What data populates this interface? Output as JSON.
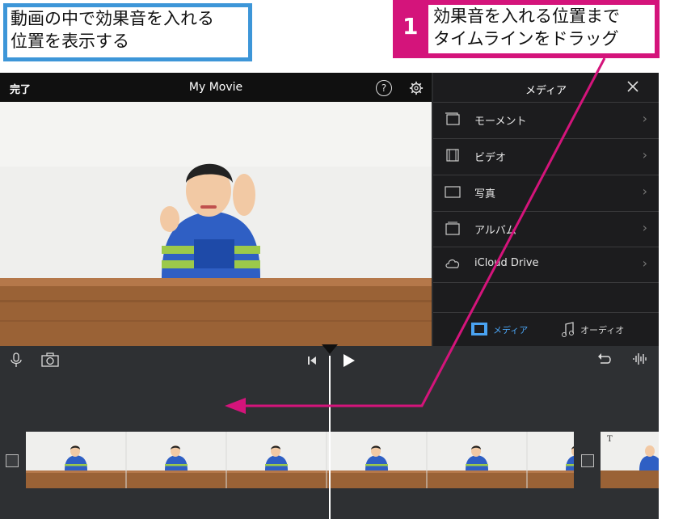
{
  "callouts": {
    "blue_line1": "動画の中で効果音を入れる",
    "blue_line2": "位置を表示する",
    "step_number": "1",
    "pink_line1": "効果音を入れる位置まで",
    "pink_line2": "タイムラインをドラッグ",
    "accent_blue": "#3d96d8",
    "accent_pink": "#d4147b"
  },
  "toolbar": {
    "done_label": "完了",
    "title": "My Movie",
    "help_glyph": "?"
  },
  "media_panel": {
    "title": "メディア",
    "items": [
      {
        "label": "モーメント",
        "icon": "moments-icon"
      },
      {
        "label": "ビデオ",
        "icon": "film-icon"
      },
      {
        "label": "写真",
        "icon": "photo-icon"
      },
      {
        "label": "アルバム",
        "icon": "album-icon"
      },
      {
        "label": "iCloud Drive",
        "icon": "cloud-icon"
      }
    ],
    "tabs": [
      {
        "label": "メディア",
        "icon": "film-icon",
        "active": true
      },
      {
        "label": "オーディオ",
        "icon": "music-note-icon",
        "active": false
      }
    ]
  },
  "timeline": {
    "tools_left": [
      "microphone-icon",
      "camera-icon"
    ],
    "tools_center": [
      "skip-back-icon",
      "play-icon"
    ],
    "tools_right": [
      "undo-icon",
      "audio-waveform-icon"
    ],
    "title_marker": "T"
  }
}
